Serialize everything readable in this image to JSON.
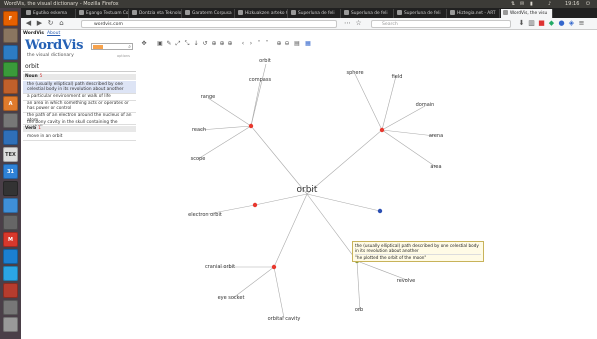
{
  "window_title": "WordVis, the visual dictionary - Mozilla Firefox",
  "tray": {
    "time": "19:16"
  },
  "launcher": [
    {
      "name": "firefox",
      "color": "#e66000",
      "glyph": "F"
    },
    {
      "name": "files",
      "color": "#8a7560",
      "glyph": ""
    },
    {
      "name": "writer",
      "color": "#2d7cc4",
      "glyph": ""
    },
    {
      "name": "calc",
      "color": "#3a9b3a",
      "glyph": ""
    },
    {
      "name": "impress",
      "color": "#c0602b",
      "glyph": ""
    },
    {
      "name": "software",
      "color": "#e07a2c",
      "glyph": "A"
    },
    {
      "name": "settings",
      "color": "#777",
      "glyph": ""
    },
    {
      "name": "thunderbird",
      "color": "#2f6fb8",
      "glyph": ""
    },
    {
      "name": "texmaker",
      "color": "#ddd",
      "glyph": "TEX"
    },
    {
      "name": "calendar",
      "color": "#2f82d6",
      "glyph": "31"
    },
    {
      "name": "terminal",
      "color": "#333",
      "glyph": ""
    },
    {
      "name": "chrome",
      "color": "#3f8fd8",
      "glyph": ""
    },
    {
      "name": "vlc",
      "color": "#666",
      "glyph": ""
    },
    {
      "name": "gmail",
      "color": "#d9382c",
      "glyph": "M"
    },
    {
      "name": "dropbox",
      "color": "#1b7fd1",
      "glyph": ""
    },
    {
      "name": "twitter",
      "color": "#2ba6e5",
      "glyph": ""
    },
    {
      "name": "app",
      "color": "#b63c2e",
      "glyph": ""
    },
    {
      "name": "disk",
      "color": "#777",
      "glyph": ""
    },
    {
      "name": "trash",
      "color": "#999",
      "glyph": ""
    }
  ],
  "tabs": [
    {
      "label": "Egutiko eskema",
      "active": false
    },
    {
      "label": "Egango Testuam Corp",
      "active": false
    },
    {
      "label": "Dontzia eta Teknolo",
      "active": false
    },
    {
      "label": "Garaterm Corpusa",
      "active": false
    },
    {
      "label": "Hizkuakzen arteko C",
      "active": false
    },
    {
      "label": "Superluna de feli",
      "active": false
    },
    {
      "label": "Superluna de feli",
      "active": false
    },
    {
      "label": "Superluna de feli",
      "active": false
    },
    {
      "label": "Hiztegia.net - ART",
      "active": false
    },
    {
      "label": "WordVis, the visu",
      "active": true
    }
  ],
  "nav": {
    "url": "wordvis.com",
    "search_placeholder": "Search"
  },
  "sidebar": {
    "app_name": "WordVis",
    "about_link": "About",
    "logo_main": "WordVis",
    "tagline": "the visual dictionary",
    "options_label": "options",
    "headword": "orbit",
    "noun_label": "Noun",
    "noun_count": "5",
    "noun_senses": [
      "the (usually elliptical) path described by one celestial body in its revolution about another",
      "a particular environment or walk of life",
      "an area in which something acts or operates or has power or control",
      "the path of an electron around the nucleus of an atom",
      "the bony cavity in the skull containing the eyeball"
    ],
    "verb_label": "Verb",
    "verb_count": "1",
    "verb_senses": [
      "move in an orbit"
    ]
  },
  "graph": {
    "center": "orbit",
    "tooltip_def": "the (usually elliptical) path described by one celestial body in its revolution about another",
    "tooltip_quote": "\"he plotted the orbit of the moon\"",
    "labels": {
      "orbit_top": "orbit",
      "compass": "compass",
      "range": "range",
      "reach": "reach",
      "scope": "scope",
      "sphere": "sphere",
      "field": "field",
      "domain": "domain",
      "arena": "arena",
      "area": "area",
      "electron_orbit": "electron orbit",
      "cranial_orbit": "cranial orbit",
      "eye_socket": "eye socket",
      "orbital_cavity": "orbital cavity",
      "revolve": "revolve",
      "orb": "orb"
    },
    "colors": {
      "red": "#e8382e",
      "blue": "#2b4fb3",
      "olive": "#8a9a3a",
      "line": "#aaaaaa"
    }
  }
}
